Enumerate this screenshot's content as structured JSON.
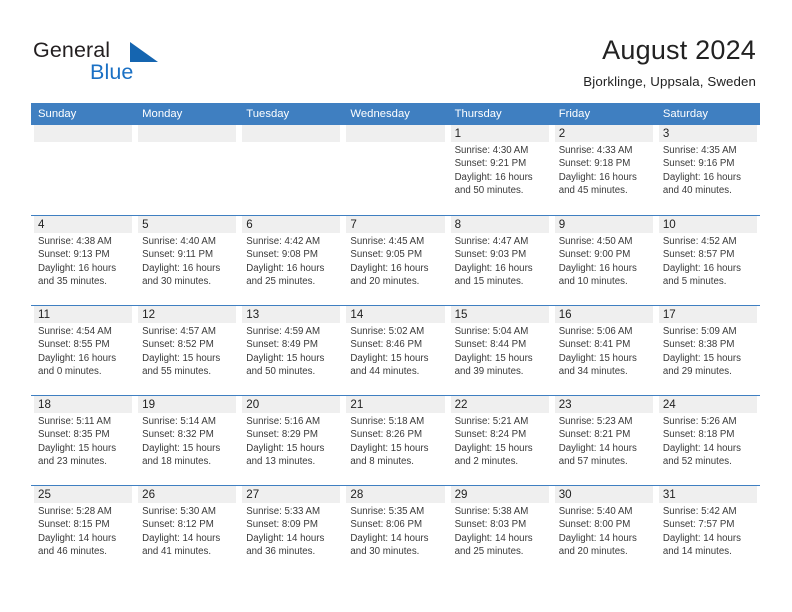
{
  "brand": {
    "word1": "General",
    "word2": "Blue",
    "logo_icon": "triangle-logo-icon",
    "accent_color": "#1a70c4"
  },
  "header": {
    "month_title": "August 2024",
    "location": "Bjorklinge, Uppsala, Sweden"
  },
  "calendar": {
    "header_bg": "#3f7fc1",
    "day_strip_bg": "#efefef",
    "weekdays": [
      "Sunday",
      "Monday",
      "Tuesday",
      "Wednesday",
      "Thursday",
      "Friday",
      "Saturday"
    ],
    "weeks": [
      [
        {
          "day": "",
          "empty": true
        },
        {
          "day": "",
          "empty": true
        },
        {
          "day": "",
          "empty": true
        },
        {
          "day": "",
          "empty": true
        },
        {
          "day": "1",
          "sunrise": "Sunrise: 4:30 AM",
          "sunset": "Sunset: 9:21 PM",
          "daylight": "Daylight: 16 hours and 50 minutes."
        },
        {
          "day": "2",
          "sunrise": "Sunrise: 4:33 AM",
          "sunset": "Sunset: 9:18 PM",
          "daylight": "Daylight: 16 hours and 45 minutes."
        },
        {
          "day": "3",
          "sunrise": "Sunrise: 4:35 AM",
          "sunset": "Sunset: 9:16 PM",
          "daylight": "Daylight: 16 hours and 40 minutes."
        }
      ],
      [
        {
          "day": "4",
          "sunrise": "Sunrise: 4:38 AM",
          "sunset": "Sunset: 9:13 PM",
          "daylight": "Daylight: 16 hours and 35 minutes."
        },
        {
          "day": "5",
          "sunrise": "Sunrise: 4:40 AM",
          "sunset": "Sunset: 9:11 PM",
          "daylight": "Daylight: 16 hours and 30 minutes."
        },
        {
          "day": "6",
          "sunrise": "Sunrise: 4:42 AM",
          "sunset": "Sunset: 9:08 PM",
          "daylight": "Daylight: 16 hours and 25 minutes."
        },
        {
          "day": "7",
          "sunrise": "Sunrise: 4:45 AM",
          "sunset": "Sunset: 9:05 PM",
          "daylight": "Daylight: 16 hours and 20 minutes."
        },
        {
          "day": "8",
          "sunrise": "Sunrise: 4:47 AM",
          "sunset": "Sunset: 9:03 PM",
          "daylight": "Daylight: 16 hours and 15 minutes."
        },
        {
          "day": "9",
          "sunrise": "Sunrise: 4:50 AM",
          "sunset": "Sunset: 9:00 PM",
          "daylight": "Daylight: 16 hours and 10 minutes."
        },
        {
          "day": "10",
          "sunrise": "Sunrise: 4:52 AM",
          "sunset": "Sunset: 8:57 PM",
          "daylight": "Daylight: 16 hours and 5 minutes."
        }
      ],
      [
        {
          "day": "11",
          "sunrise": "Sunrise: 4:54 AM",
          "sunset": "Sunset: 8:55 PM",
          "daylight": "Daylight: 16 hours and 0 minutes."
        },
        {
          "day": "12",
          "sunrise": "Sunrise: 4:57 AM",
          "sunset": "Sunset: 8:52 PM",
          "daylight": "Daylight: 15 hours and 55 minutes."
        },
        {
          "day": "13",
          "sunrise": "Sunrise: 4:59 AM",
          "sunset": "Sunset: 8:49 PM",
          "daylight": "Daylight: 15 hours and 50 minutes."
        },
        {
          "day": "14",
          "sunrise": "Sunrise: 5:02 AM",
          "sunset": "Sunset: 8:46 PM",
          "daylight": "Daylight: 15 hours and 44 minutes."
        },
        {
          "day": "15",
          "sunrise": "Sunrise: 5:04 AM",
          "sunset": "Sunset: 8:44 PM",
          "daylight": "Daylight: 15 hours and 39 minutes."
        },
        {
          "day": "16",
          "sunrise": "Sunrise: 5:06 AM",
          "sunset": "Sunset: 8:41 PM",
          "daylight": "Daylight: 15 hours and 34 minutes."
        },
        {
          "day": "17",
          "sunrise": "Sunrise: 5:09 AM",
          "sunset": "Sunset: 8:38 PM",
          "daylight": "Daylight: 15 hours and 29 minutes."
        }
      ],
      [
        {
          "day": "18",
          "sunrise": "Sunrise: 5:11 AM",
          "sunset": "Sunset: 8:35 PM",
          "daylight": "Daylight: 15 hours and 23 minutes."
        },
        {
          "day": "19",
          "sunrise": "Sunrise: 5:14 AM",
          "sunset": "Sunset: 8:32 PM",
          "daylight": "Daylight: 15 hours and 18 minutes."
        },
        {
          "day": "20",
          "sunrise": "Sunrise: 5:16 AM",
          "sunset": "Sunset: 8:29 PM",
          "daylight": "Daylight: 15 hours and 13 minutes."
        },
        {
          "day": "21",
          "sunrise": "Sunrise: 5:18 AM",
          "sunset": "Sunset: 8:26 PM",
          "daylight": "Daylight: 15 hours and 8 minutes."
        },
        {
          "day": "22",
          "sunrise": "Sunrise: 5:21 AM",
          "sunset": "Sunset: 8:24 PM",
          "daylight": "Daylight: 15 hours and 2 minutes."
        },
        {
          "day": "23",
          "sunrise": "Sunrise: 5:23 AM",
          "sunset": "Sunset: 8:21 PM",
          "daylight": "Daylight: 14 hours and 57 minutes."
        },
        {
          "day": "24",
          "sunrise": "Sunrise: 5:26 AM",
          "sunset": "Sunset: 8:18 PM",
          "daylight": "Daylight: 14 hours and 52 minutes."
        }
      ],
      [
        {
          "day": "25",
          "sunrise": "Sunrise: 5:28 AM",
          "sunset": "Sunset: 8:15 PM",
          "daylight": "Daylight: 14 hours and 46 minutes."
        },
        {
          "day": "26",
          "sunrise": "Sunrise: 5:30 AM",
          "sunset": "Sunset: 8:12 PM",
          "daylight": "Daylight: 14 hours and 41 minutes."
        },
        {
          "day": "27",
          "sunrise": "Sunrise: 5:33 AM",
          "sunset": "Sunset: 8:09 PM",
          "daylight": "Daylight: 14 hours and 36 minutes."
        },
        {
          "day": "28",
          "sunrise": "Sunrise: 5:35 AM",
          "sunset": "Sunset: 8:06 PM",
          "daylight": "Daylight: 14 hours and 30 minutes."
        },
        {
          "day": "29",
          "sunrise": "Sunrise: 5:38 AM",
          "sunset": "Sunset: 8:03 PM",
          "daylight": "Daylight: 14 hours and 25 minutes."
        },
        {
          "day": "30",
          "sunrise": "Sunrise: 5:40 AM",
          "sunset": "Sunset: 8:00 PM",
          "daylight": "Daylight: 14 hours and 20 minutes."
        },
        {
          "day": "31",
          "sunrise": "Sunrise: 5:42 AM",
          "sunset": "Sunset: 7:57 PM",
          "daylight": "Daylight: 14 hours and 14 minutes."
        }
      ]
    ]
  }
}
